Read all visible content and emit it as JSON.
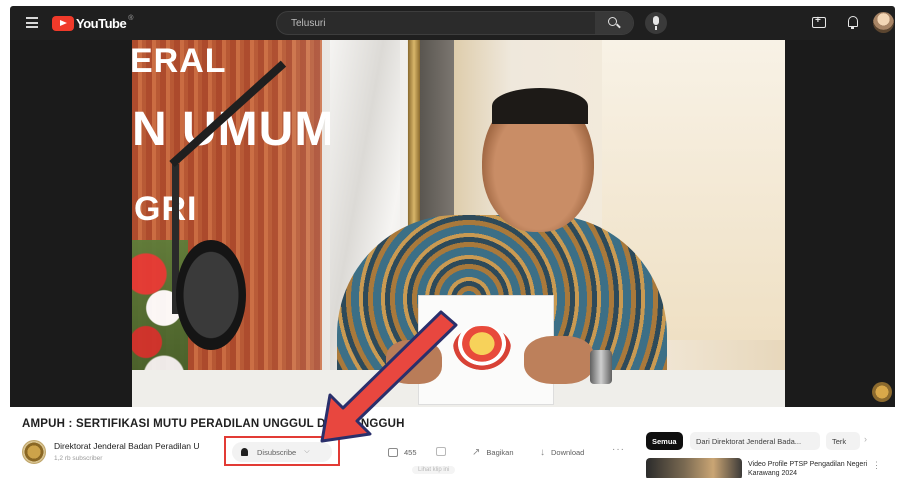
{
  "header": {
    "logo_text": "YouTube",
    "logo_reg": "®",
    "search_placeholder": "Telusuri",
    "icons": [
      "menu-icon",
      "search-icon",
      "mic-icon",
      "create-icon",
      "bell-icon",
      "avatar"
    ]
  },
  "video": {
    "wall_text": [
      "ERAL",
      "N UMUM",
      "GRI"
    ],
    "title": "AMPUH : SERTIFIKASI MUTU PERADILAN UNGGUL DAN TANGGUH"
  },
  "channel": {
    "name": "Direktorat Jenderal Badan Peradilan U",
    "subscribers": "1,2 rb subscriber"
  },
  "actions": {
    "subscribed_label": "Disubscribe",
    "subscribed_chevron": "⌵",
    "like_count": "455",
    "share_label": "Bagikan",
    "share_icon": "↗",
    "download_label": "Download",
    "download_icon": "↓",
    "more_label": "···",
    "faint_label": "Lihat klip ini"
  },
  "sidebar": {
    "chips": [
      "Semua",
      "Dari Direktorat Jenderal Bada...",
      "Terk"
    ],
    "chip_next": "›",
    "recommendation": {
      "title": "Video Profile PTSP Pengadilan Negeri Karawang 2024",
      "more": "⋮"
    }
  },
  "colors": {
    "topbar": "#1f1f1f",
    "youtube_red": "#f03a2a",
    "highlight_red": "#e23b35",
    "arrow_outline": "#2a2f6b"
  }
}
